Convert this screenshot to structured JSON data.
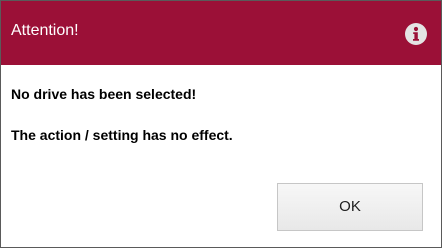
{
  "dialog": {
    "title": "Attention!",
    "icon": "info-icon",
    "messages": [
      "No drive has been selected!",
      "The action / setting has no effect."
    ],
    "ok_label": "OK"
  },
  "colors": {
    "titlebar": "#9b1037",
    "title_text": "#ffffff",
    "icon_bg": "#e4e4e4",
    "icon_glyph": "#9b1037"
  }
}
